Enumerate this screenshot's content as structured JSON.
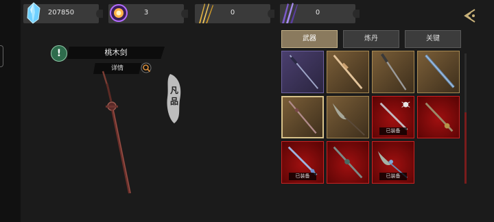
{
  "resources": [
    {
      "name": "spirit-crystal",
      "value": "207850"
    },
    {
      "name": "purple-orb",
      "value": "3"
    },
    {
      "name": "golden-feathers",
      "value": "0"
    },
    {
      "name": "purple-blades",
      "value": "0"
    }
  ],
  "item": {
    "name": "桃木剑",
    "detail_label": "详情",
    "rank": "凡品",
    "info_glyph": "!"
  },
  "tabs": [
    {
      "label": "武器",
      "active": true
    },
    {
      "label": "炼丹",
      "active": false
    },
    {
      "label": "关键",
      "active": false
    }
  ],
  "inventory": [
    {
      "rarity": "purple",
      "icon": "dark-sword-icon",
      "equipped_label": "",
      "selected": false
    },
    {
      "rarity": "gold",
      "icon": "peach-wood-sword-icon",
      "equipped_label": "",
      "selected": false
    },
    {
      "rarity": "gold",
      "icon": "steel-sword-icon",
      "equipped_label": "",
      "selected": false
    },
    {
      "rarity": "gold",
      "icon": "blue-sword-icon",
      "equipped_label": "",
      "selected": false
    },
    {
      "rarity": "gold",
      "icon": "peach-wood-sword-icon",
      "equipped_label": "",
      "selected": true
    },
    {
      "rarity": "gold",
      "icon": "horsetail-whisk-icon",
      "equipped_label": "",
      "selected": false
    },
    {
      "rarity": "red",
      "icon": "spider-blade-icon",
      "equipped_label": "已装备",
      "selected": false
    },
    {
      "rarity": "red",
      "icon": "bronze-sword-icon",
      "equipped_label": "",
      "selected": false
    },
    {
      "rarity": "red",
      "icon": "azure-sword-icon",
      "equipped_label": "已装备",
      "selected": false
    },
    {
      "rarity": "red",
      "icon": "jade-sword-icon",
      "equipped_label": "",
      "selected": false
    },
    {
      "rarity": "red",
      "icon": "jade-whisk-icon",
      "equipped_label": "已装备",
      "selected": false
    }
  ],
  "colors": {
    "purple": "#4a3f6e",
    "gold": "#7a5e38",
    "red": "#a01010",
    "tab_active": "#8a7a5e"
  }
}
